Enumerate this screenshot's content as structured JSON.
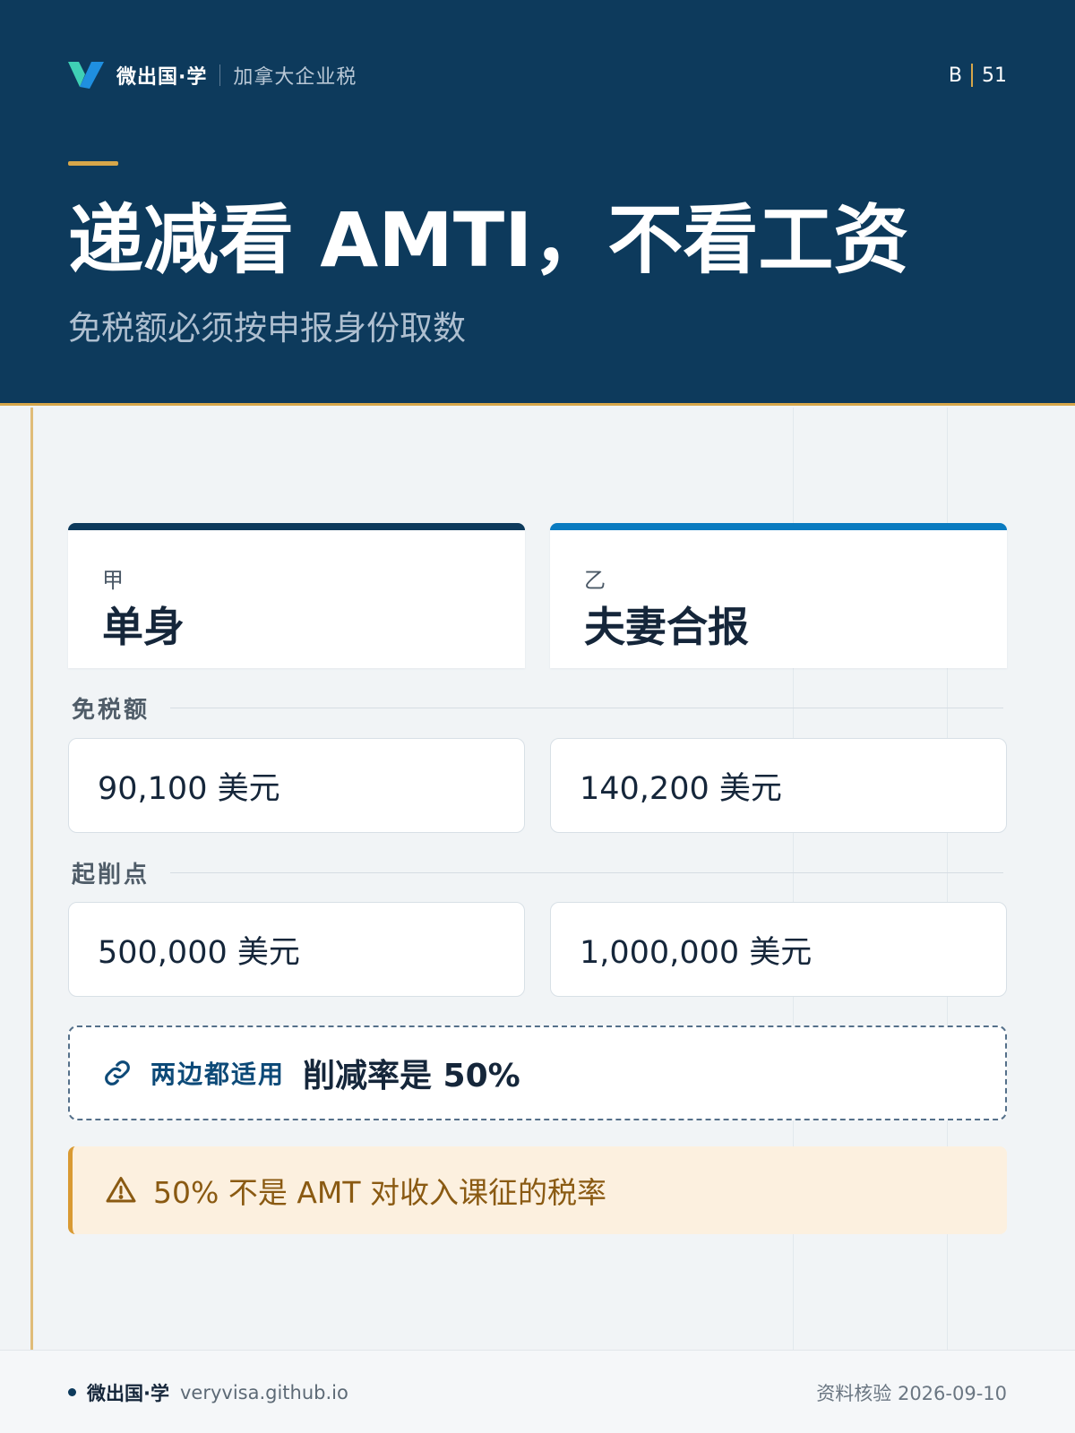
{
  "header": {
    "brand_name": "微出国·学",
    "brand_sub": "加拿大企业税",
    "page_prefix": "B",
    "page_number": "51",
    "title": "递减看 AMTI，不看工资",
    "subtitle": "免税额必须按申报身份取数"
  },
  "columns": [
    {
      "letter": "甲",
      "name": "单身"
    },
    {
      "letter": "乙",
      "name": "夫妻合报"
    }
  ],
  "sections": [
    {
      "label": "免税额",
      "values": [
        "90,100 美元",
        "140,200 美元"
      ]
    },
    {
      "label": "起削点",
      "values": [
        "500,000 美元",
        "1,000,000 美元"
      ]
    }
  ],
  "note": {
    "icon": "link-icon",
    "label": "两边都适用",
    "text": "削减率是 50%"
  },
  "warning": {
    "icon": "warning-icon",
    "text": "50% 不是 AMT 对收入课征的税率"
  },
  "footer": {
    "brand": "微出国·学",
    "url": "veryvisa.github.io",
    "verified": "资料核验 2026-09-10"
  },
  "colors": {
    "header_bg": "#0d3a5c",
    "accent_gold": "#d6a64a",
    "accent_blue": "#0a7bc0",
    "warning_bg": "#fcf0df"
  }
}
